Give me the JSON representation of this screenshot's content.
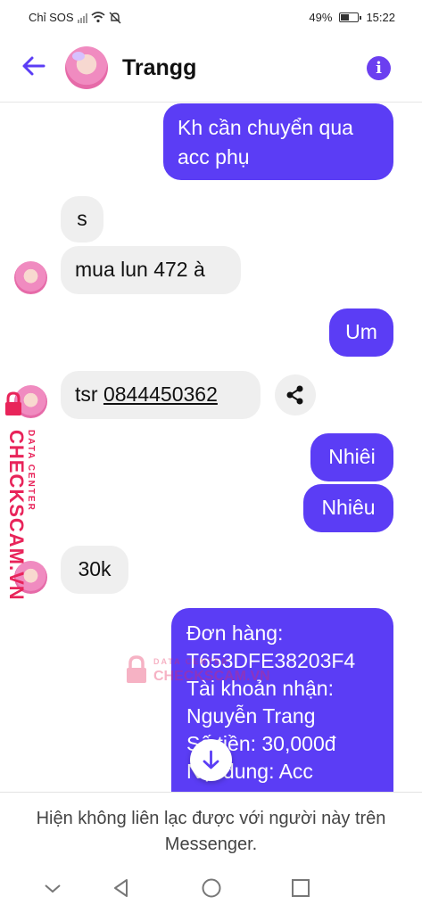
{
  "status_bar": {
    "carrier": "Chỉ SOS",
    "battery": "49%",
    "time": "15:22"
  },
  "header": {
    "contact_name": "Trangg"
  },
  "messages": [
    {
      "side": "out",
      "text": "Kh cần chuyển qua acc phụ"
    },
    {
      "side": "in",
      "text": "s"
    },
    {
      "side": "in",
      "text": "mua lun 472 à"
    },
    {
      "side": "out",
      "text": "Um"
    },
    {
      "side": "in",
      "prefix": "tsr ",
      "phone": "0844450362"
    },
    {
      "side": "out",
      "text": "Nhiêi"
    },
    {
      "side": "out",
      "text": "Nhiêu"
    },
    {
      "side": "in",
      "text": "30k"
    },
    {
      "side": "out",
      "lines": [
        "Đơn hàng:",
        "T653DFE38203F4",
        "Tài khoản nhận:",
        "Nguyễn Trang",
        "Số tiền: 30,000đ",
        "Nội dung: Acc"
      ]
    }
  ],
  "watermark": {
    "main": "CHECKSCAM.VN",
    "sub": "DATA CENTER",
    "center_sub": "DATA CENTER",
    "center_main": "CHECKSCAM.VN"
  },
  "footer": {
    "notice": "Hiện không liên lạc được với người này trên Messenger."
  },
  "colors": {
    "accent": "#5b3df5",
    "incoming_bubble": "#efefef",
    "watermark": "#e8245a"
  }
}
